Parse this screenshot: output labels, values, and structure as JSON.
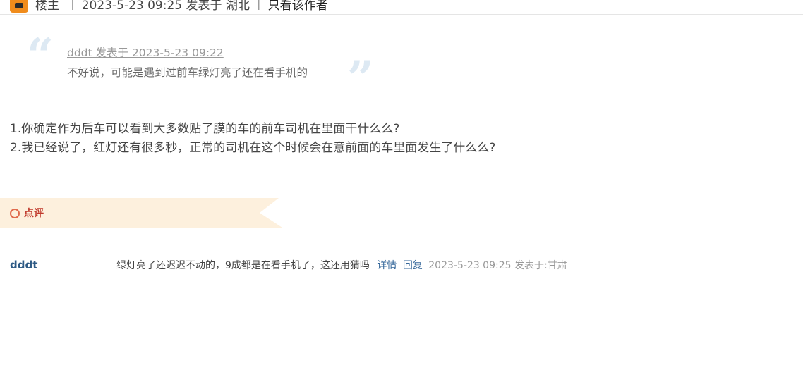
{
  "topbar": {
    "icon": "original-poster-icon",
    "op_label": "楼主",
    "separator": "|",
    "post_info": "2023-5-23 09:25 发表于 湖北",
    "separator2": "|",
    "only_author": "只看该作者"
  },
  "quote": {
    "meta": "dddt 发表于 2023-5-23 09:22",
    "text": "不好说，可能是遇到过前车绿灯亮了还在看手机的"
  },
  "post": {
    "lines": [
      "1.你确定作为后车可以看到大多数贴了膜的车的前车司机在里面干什么么?",
      "2.我已经说了，红灯还有很多秒，正常的司机在这个时候会在意前面的车里面发生了什么么?"
    ]
  },
  "comments": {
    "title": "点评",
    "accent_color": "#fdf0dd",
    "items": [
      {
        "user": "dddt",
        "text": "绿灯亮了还迟迟不动的，9成都是在看手机了，这还用猜吗",
        "detail_label": "详情",
        "reply_label": "回复",
        "time": "2023-5-23 09:25 发表于:甘肃"
      }
    ]
  }
}
